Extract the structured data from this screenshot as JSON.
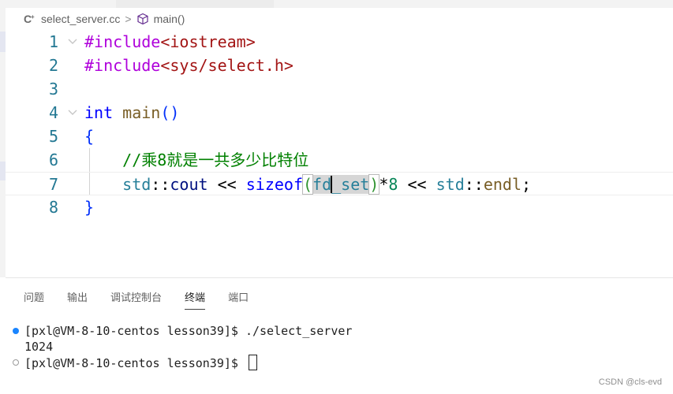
{
  "breadcrumb": {
    "file_icon": "cpp-file-icon",
    "file_name": "select_server.cc",
    "separator": ">",
    "symbol_icon": "method-cube-icon",
    "symbol_name": "main()"
  },
  "editor": {
    "line_numbers": [
      "1",
      "2",
      "3",
      "4",
      "5",
      "6",
      "7",
      "8"
    ],
    "lines": {
      "l1": {
        "directive": "#include",
        "header": "<iostream>"
      },
      "l2": {
        "directive": "#include",
        "header": "<sys/select.h>"
      },
      "l4": {
        "type": "int",
        "name": "main",
        "paren_open": "(",
        "paren_close": ")"
      },
      "l5": {
        "brace": "{"
      },
      "l6": {
        "comment_prefix": "//乘",
        "comment_num": "8",
        "comment_rest": "就是一共多少比特位"
      },
      "l7": {
        "ns1": "std",
        "op1": "::",
        "obj": "cout",
        "shift1": " << ",
        "sizeof": "sizeof",
        "paren_open": "(",
        "arg_a": "fd",
        "arg_b": "_set",
        "paren_close": ")",
        "mul": "*",
        "num": "8",
        "shift2": " << ",
        "ns2": "std",
        "op2": "::",
        "endl": "endl",
        "semi": ";"
      },
      "l8": {
        "brace": "}"
      }
    },
    "fold_icon": "chevron-down-icon"
  },
  "panel": {
    "tabs": [
      "问题",
      "输出",
      "调试控制台",
      "终端",
      "端口"
    ],
    "active_tab": "终端",
    "terminal": {
      "line1": "[pxl@VM-8-10-centos lesson39]$ ./select_server",
      "line2": "1024",
      "line3": "[pxl@VM-8-10-centos lesson39]$ "
    }
  },
  "watermark": "CSDN @cls-evd",
  "colors": {
    "keyword": "#0000ff",
    "preprocessor": "#af00db",
    "string": "#a31515",
    "comment": "#008000",
    "line_number": "#237893",
    "terminal_dot_active": "#1a85ff"
  }
}
